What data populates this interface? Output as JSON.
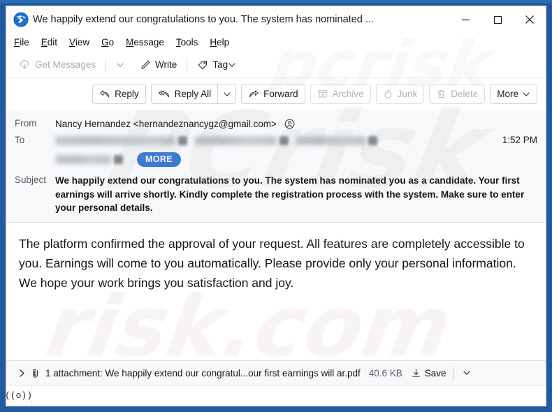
{
  "window": {
    "title": "We happily extend our congratulations to you. The system has nominated ...",
    "app_icon": "thunderbird-icon",
    "minimize_label": "Minimize",
    "maximize_label": "Maximize",
    "close_label": "Close"
  },
  "menubar": {
    "items": [
      {
        "label": "File",
        "accesskey": "F"
      },
      {
        "label": "Edit",
        "accesskey": "E"
      },
      {
        "label": "View",
        "accesskey": "V"
      },
      {
        "label": "Go",
        "accesskey": "G"
      },
      {
        "label": "Message",
        "accesskey": "M"
      },
      {
        "label": "Tools",
        "accesskey": "T"
      },
      {
        "label": "Help",
        "accesskey": "H"
      }
    ]
  },
  "toolbar": {
    "get_messages": "Get Messages",
    "write": "Write",
    "tag": "Tag"
  },
  "message_actions": {
    "reply": "Reply",
    "reply_all": "Reply All",
    "forward": "Forward",
    "archive": "Archive",
    "junk": "Junk",
    "delete": "Delete",
    "more": "More"
  },
  "message": {
    "from_label": "From",
    "from_value": "Nancy Hernandez <hernandeznancygz@gmail.com>",
    "to_label": "To",
    "to_value_redacted": "",
    "more_recipients_label": "MORE",
    "time": "1:52 PM",
    "subject_label": "Subject",
    "subject_value": "We happily extend our congratulations to you. The system has nominated you as a candidate. Your first earnings will arrive shortly. Kindly complete the registration process with the system. Make sure to enter your personal details.",
    "body": "The platform confirmed the approval of your request. All features are completely accessible to you. Earnings will come to you automatically. Please provide only your personal information. We hope your work brings you satisfaction and joy."
  },
  "attachment": {
    "summary": "1 attachment: We happily extend our congratul...our first earnings will ar.pdf",
    "size": "40.6 KB",
    "save_label": "Save"
  },
  "statusbar": {
    "remote_content_icon": "((o))"
  },
  "watermark": {
    "line1": "PCrisk",
    "line2": "risk.com",
    "line3": "pcrisk"
  },
  "colors": {
    "frame_blue": "#215a9e",
    "accent_pill_blue": "#3b78d8",
    "header_bg": "#f7f8f9",
    "disabled_text": "#a9aeb4"
  }
}
